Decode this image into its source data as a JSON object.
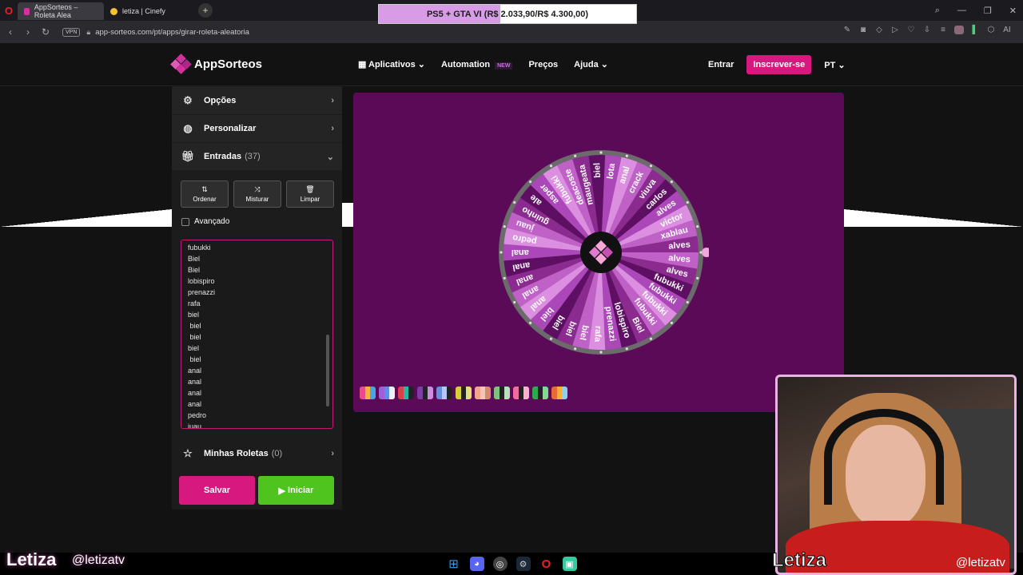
{
  "browser": {
    "tabs": [
      {
        "title": "AppSorteos – Roleta Alea",
        "active": true
      },
      {
        "title": "letiza | Cinefy",
        "active": false
      }
    ],
    "url": "app-sorteos.com/pt/apps/girar-roleta-aleatoria",
    "vpn_label": "VPN",
    "ai_label": "AI"
  },
  "promo": {
    "text": "PS5 + GTA VI (R$ 2.033,90/R$ 4.300,00)",
    "progress": 0.473
  },
  "header": {
    "brand": "AppSorteos",
    "nav": [
      {
        "label": "Aplicativos"
      },
      {
        "label": "Automation",
        "badge": "NEW"
      },
      {
        "label": "Preços"
      },
      {
        "label": "Ajuda"
      }
    ],
    "login": "Entrar",
    "signup": "Inscrever-se",
    "lang": "PT"
  },
  "sidebar": {
    "options": "Opções",
    "customize": "Personalizar",
    "entries_label": "Entradas",
    "entries_count": "(37)",
    "tools": {
      "sort": "Ordenar",
      "shuffle": "Misturar",
      "clear": "Limpar"
    },
    "advanced": "Avançado",
    "entry_lines": [
      "fubukki",
      "Biel",
      "Biel",
      "lobispiro",
      "prenazzi",
      "rafa",
      "biel",
      " biel",
      " biel",
      "biel",
      " biel",
      "anal",
      "anal",
      "anal",
      "anal",
      "pedro",
      "juau"
    ],
    "my_wheels": "Minhas Roletas",
    "my_wheels_count": "(0)",
    "save": "Salvar",
    "start": "Iniciar"
  },
  "wheel": {
    "labels": [
      "alves",
      "alves",
      "fubukki",
      "fubukki",
      "fubukki",
      "fubukki",
      "Biel",
      "lobispiro",
      "prenazzi",
      "rafa",
      "biel",
      "biel",
      "biel",
      "biel",
      "anal",
      "anal",
      "anal",
      "anal",
      "anal",
      "pedro",
      "juau",
      "guinho",
      "ale",
      "asper",
      "fubukki",
      "deacoste",
      "maugeata",
      "biel",
      "lota",
      "anal",
      "crack",
      "viuva",
      "carlos",
      "alves",
      "victor",
      "xablau",
      "alves"
    ],
    "colors": [
      "#c061c8",
      "#8b2a8f",
      "#5e0f63",
      "#ab47b8",
      "#dc8fe0"
    ],
    "palette_count": 11
  },
  "stream": {
    "name": "Letiza",
    "handle": "@letizatv"
  }
}
